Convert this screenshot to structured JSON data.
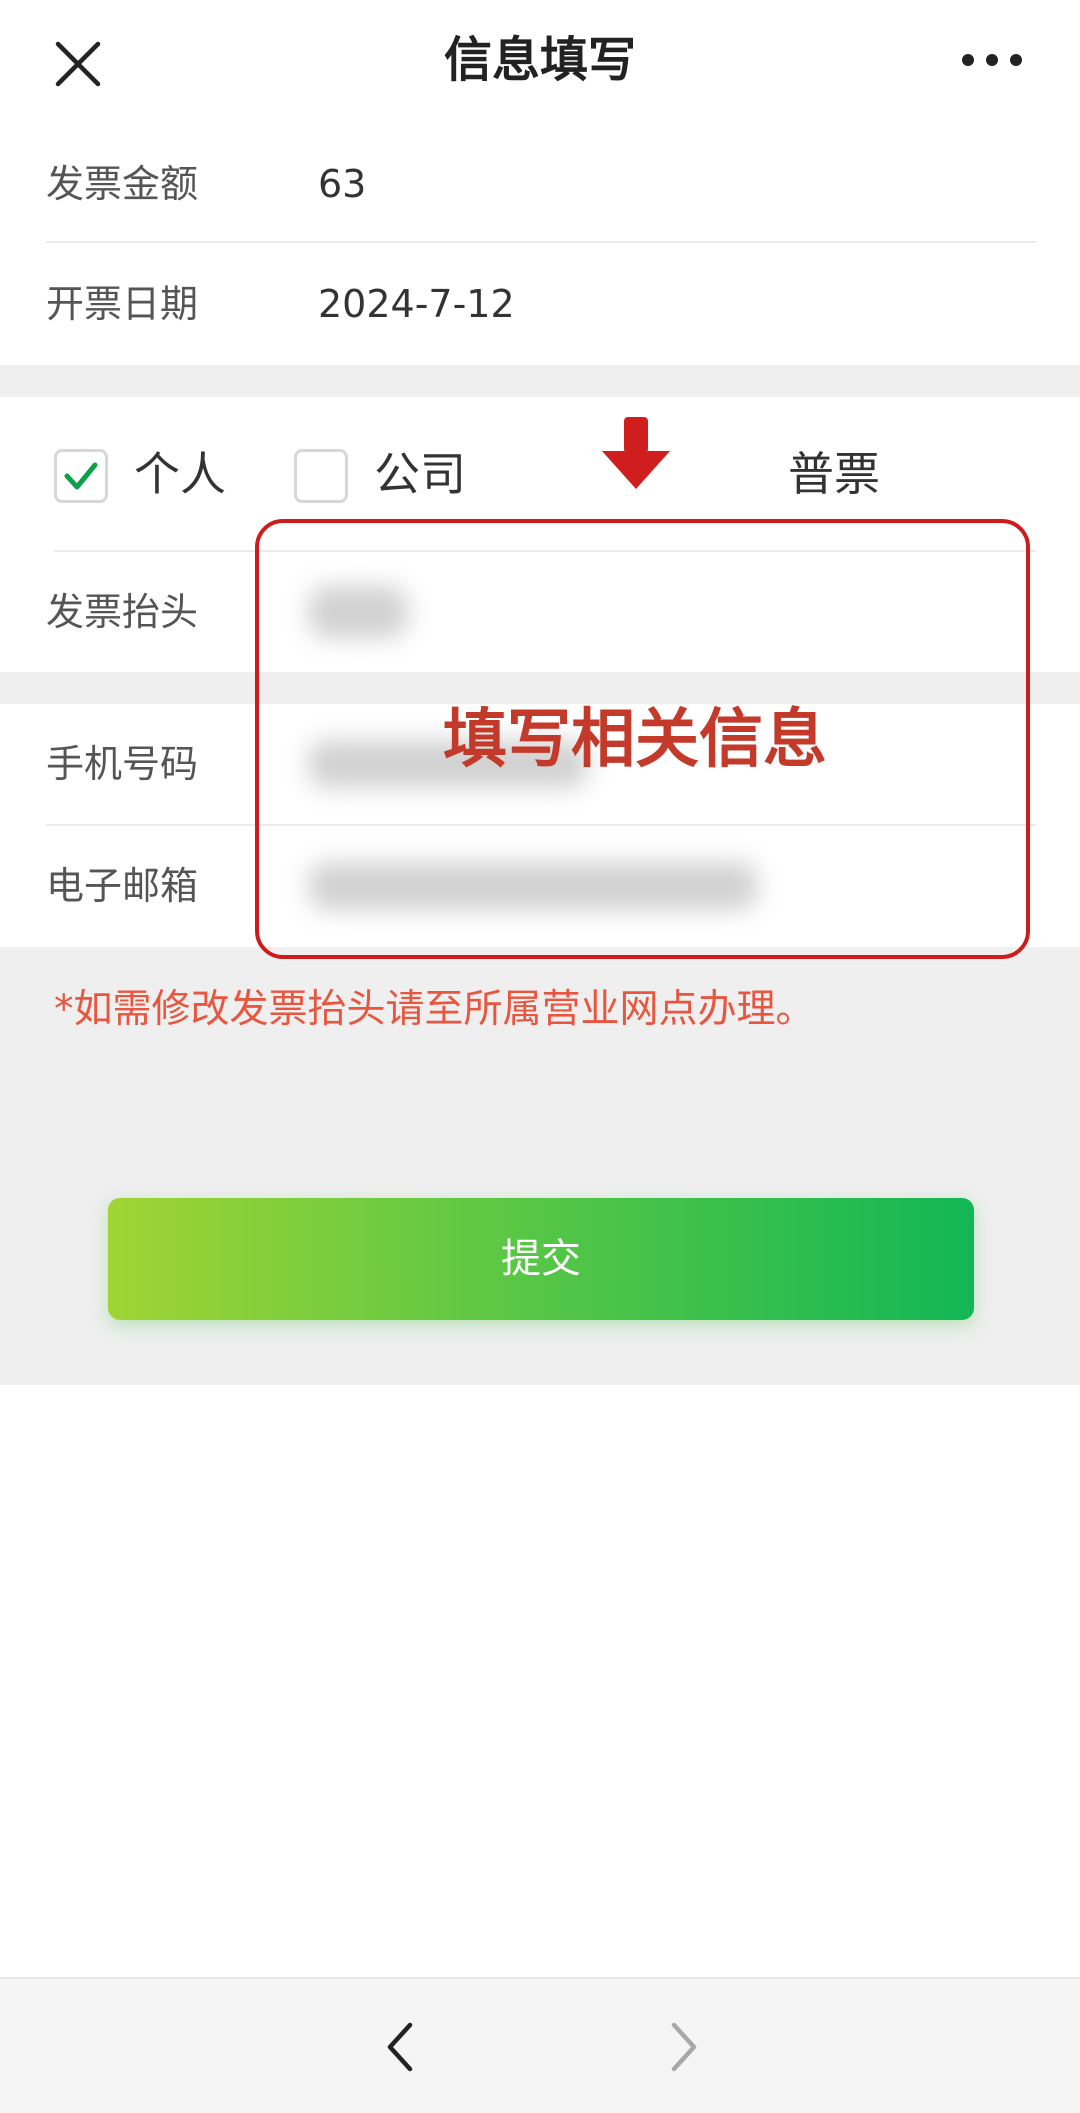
{
  "header": {
    "title": "信息填写",
    "close_icon": "close-icon",
    "more_icon": "more-icon"
  },
  "invoice": {
    "amount_label": "发票金额",
    "amount_value": "63",
    "date_label": "开票日期",
    "date_value": "2024-7-12"
  },
  "invoice_type": {
    "personal_label": "个人",
    "personal_checked": true,
    "company_label": "公司",
    "company_checked": false,
    "ticket_type": "普票"
  },
  "form": {
    "title_label": "发票抬头",
    "phone_label": "手机号码",
    "email_label": "电子邮箱"
  },
  "annotation": {
    "text": "填写相关信息",
    "color": "#cf1b1b"
  },
  "notice": "*如需修改发票抬头请至所属营业网点办理。",
  "submit_label": "提交",
  "colors": {
    "accent_green": "#12b755",
    "notice_red": "#e8563f",
    "check_green": "#0aa14a"
  },
  "bottom_nav": {
    "back_icon": "chevron-left-icon",
    "forward_icon": "chevron-right-icon"
  }
}
